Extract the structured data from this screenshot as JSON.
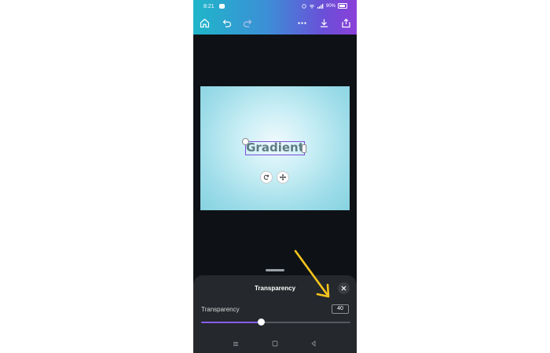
{
  "status_bar": {
    "time": "8:21",
    "battery": "90%"
  },
  "toolbar": {
    "icons": [
      "home-icon",
      "undo-icon",
      "redo-icon",
      "more-icon",
      "download-icon",
      "share-icon"
    ]
  },
  "canvas": {
    "text": "Gradient",
    "background_colors": [
      "#eef9fc",
      "#86d2e0"
    ],
    "selection_color": "#7c4ddb"
  },
  "panel": {
    "title": "Transparency",
    "slider_label": "Transparency",
    "value": "40",
    "fraction": 0.4
  },
  "colors": {
    "accent": "#8b5cf6",
    "annotation_arrow": "#f5c51c",
    "gradient_start": "#1fb6c9",
    "gradient_end": "#8a3fd9"
  }
}
